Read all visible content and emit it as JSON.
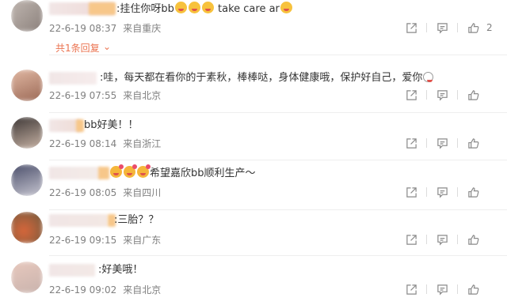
{
  "comments": [
    {
      "text": ":挂住你呀bb",
      "text_tail": " take care ar",
      "time": "22-6-19 08:37",
      "source": "来自重庆",
      "likes": "2",
      "emojis_mid": 3,
      "emojis_end": 1
    },
    {
      "text": ":哇，每天都在看你的于素秋，棒棒哒，身体健康哦，保护好自己，爱你",
      "time": "22-6-19 07:55",
      "source": "来自北京",
      "likes": "",
      "emojis_end": 1
    },
    {
      "text": "bb好美！！",
      "time": "22-6-19 08:14",
      "source": "来自浙江",
      "likes": ""
    },
    {
      "text": "希望嘉欣bb顺利生产～",
      "time": "22-6-19 08:05",
      "source": "来自四川",
      "likes": "",
      "emojis_pre": 3
    },
    {
      "text": ":三胎？？",
      "time": "22-6-19 09:15",
      "source": "来自广东",
      "likes": ""
    },
    {
      "text": ":好美哦！",
      "time": "22-6-19 09:02",
      "source": "来自北京",
      "likes": ""
    }
  ],
  "reply_link": "共1条回复",
  "colors": {
    "accent": "#eb7350",
    "meta": "#808080"
  },
  "icons": [
    "share-icon",
    "comment-icon",
    "like-icon"
  ]
}
